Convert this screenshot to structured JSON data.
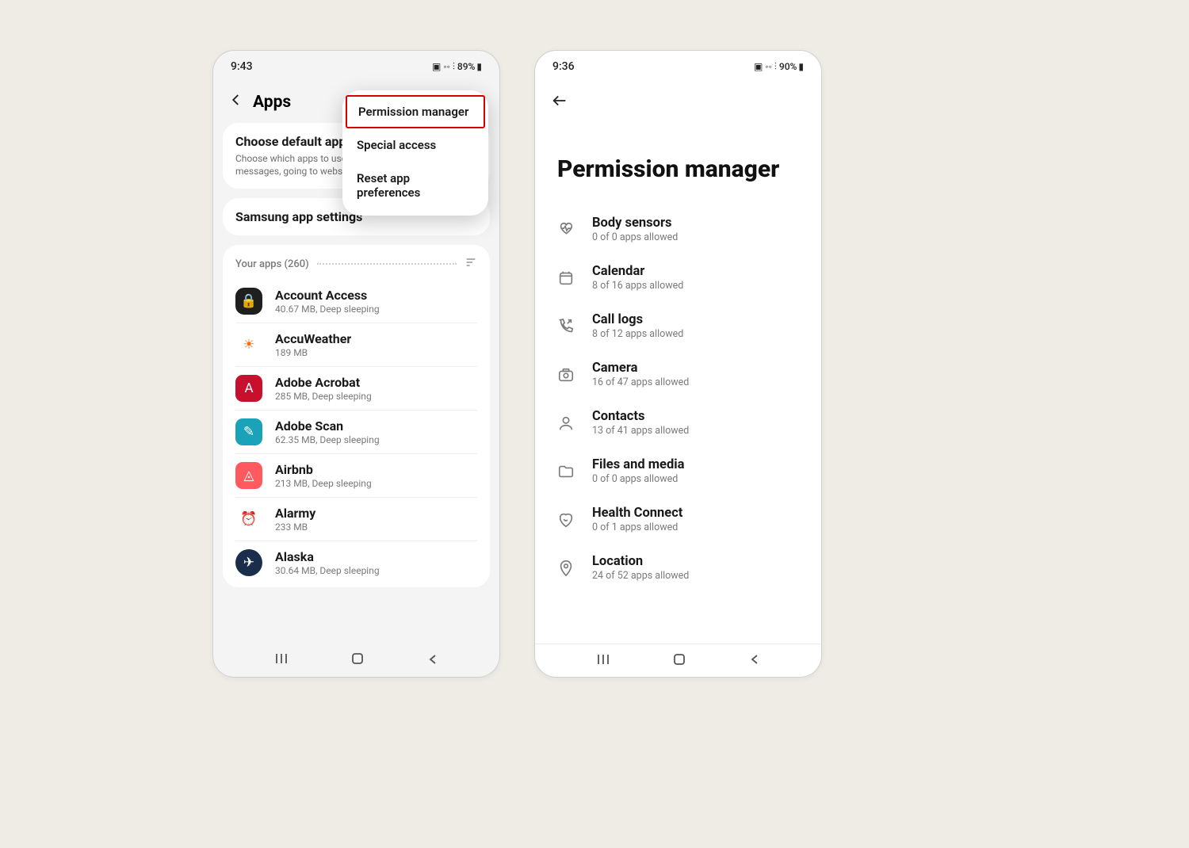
{
  "left": {
    "time": "9:43",
    "battery": "89%",
    "title": "Apps",
    "menu": {
      "items": [
        "Permission manager",
        "Special access",
        "Reset app preferences"
      ],
      "highlighted": 0
    },
    "default_card": {
      "title": "Choose default apps",
      "sub": "Choose which apps to use for making calls, sending messages, going to websites, and more."
    },
    "samsung_card": "Samsung app settings",
    "your_apps_label": "Your apps (260)",
    "apps": [
      {
        "name": "Account Access",
        "sub": "40.67 MB, Deep sleeping",
        "icon": "account",
        "glyph": "🔒"
      },
      {
        "name": "AccuWeather",
        "sub": "189 MB",
        "icon": "accu",
        "glyph": "☀"
      },
      {
        "name": "Adobe Acrobat",
        "sub": "285 MB, Deep sleeping",
        "icon": "acrobat",
        "glyph": "A"
      },
      {
        "name": "Adobe Scan",
        "sub": "62.35 MB, Deep sleeping",
        "icon": "scan",
        "glyph": "✎"
      },
      {
        "name": "Airbnb",
        "sub": "213 MB, Deep sleeping",
        "icon": "airbnb",
        "glyph": "◬"
      },
      {
        "name": "Alarmy",
        "sub": "233 MB",
        "icon": "alarmy",
        "glyph": "⏰"
      },
      {
        "name": "Alaska",
        "sub": "30.64 MB, Deep sleeping",
        "icon": "alaska",
        "glyph": "✈"
      }
    ]
  },
  "right": {
    "time": "9:36",
    "battery": "90%",
    "title": "Permission manager",
    "permissions": [
      {
        "name": "Body sensors",
        "sub": "0 of 0 apps allowed",
        "icon": "heart"
      },
      {
        "name": "Calendar",
        "sub": "8 of 16 apps allowed",
        "icon": "calendar"
      },
      {
        "name": "Call logs",
        "sub": "8 of 12 apps allowed",
        "icon": "phone"
      },
      {
        "name": "Camera",
        "sub": "16 of 47 apps allowed",
        "icon": "camera"
      },
      {
        "name": "Contacts",
        "sub": "13 of 41 apps allowed",
        "icon": "person"
      },
      {
        "name": "Files and media",
        "sub": "0 of 0 apps allowed",
        "icon": "folder"
      },
      {
        "name": "Health Connect",
        "sub": "0 of 1 apps allowed",
        "icon": "health"
      },
      {
        "name": "Location",
        "sub": "24 of 52 apps allowed",
        "icon": "location"
      }
    ]
  }
}
